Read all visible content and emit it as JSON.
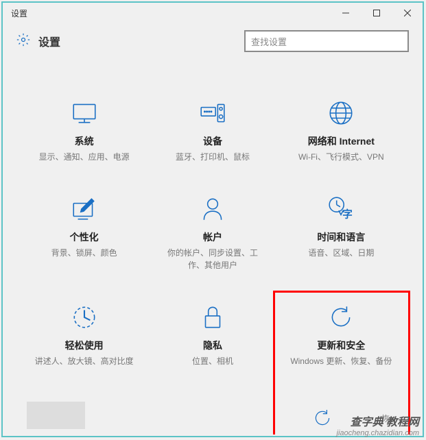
{
  "window": {
    "title": "设置"
  },
  "header": {
    "title": "设置"
  },
  "search": {
    "placeholder": "查找设置"
  },
  "tiles": [
    {
      "title": "系统",
      "desc": "显示、通知、应用、电源"
    },
    {
      "title": "设备",
      "desc": "蓝牙、打印机、鼠标"
    },
    {
      "title": "网络和 Internet",
      "desc": "Wi-Fi、飞行模式、VPN"
    },
    {
      "title": "个性化",
      "desc": "背景、锁屏、颜色"
    },
    {
      "title": "帐户",
      "desc": "你的帐户、同步设置、工作、其他用户"
    },
    {
      "title": "时间和语言",
      "desc": "语音、区域、日期"
    },
    {
      "title": "轻松使用",
      "desc": "讲述人、放大镜、高对比度"
    },
    {
      "title": "隐私",
      "desc": "位置、相机"
    },
    {
      "title": "更新和安全",
      "desc": "Windows 更新、恢复、备份"
    }
  ],
  "partial": {
    "text": "恢"
  },
  "watermark": {
    "main": "查字典 教程网",
    "sub": "jiaocheng.chazidian.com"
  }
}
